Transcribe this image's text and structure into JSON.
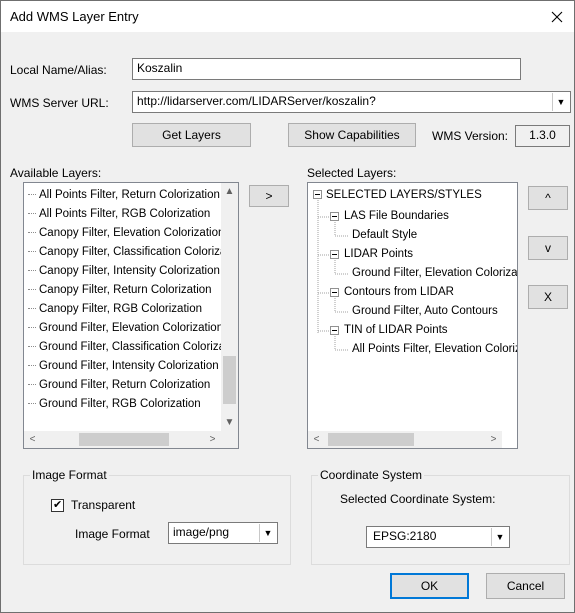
{
  "dialog": {
    "title": "Add WMS Layer Entry",
    "close_glyph": "✕"
  },
  "fields": {
    "local_name_label": "Local Name/Alias:",
    "local_name_value": "Koszalin",
    "wms_url_label": "WMS Server URL:",
    "wms_url_value": "http://lidarserver.com/LIDARServer/koszalin?"
  },
  "buttons": {
    "get_layers": "Get Layers",
    "show_capabilities": "Show Capabilities",
    "add_layer": ">",
    "move_up": "^",
    "move_down": "v",
    "remove": "X",
    "ok": "OK",
    "cancel": "Cancel"
  },
  "wms_version": {
    "label": "WMS Version:",
    "value": "1.3.0"
  },
  "available_layers": {
    "label": "Available Layers:",
    "items": [
      "All Points Filter, Return Colorization",
      "All Points Filter, RGB Colorization",
      "Canopy Filter, Elevation Colorization",
      "Canopy Filter, Classification Colorization",
      "Canopy Filter, Intensity Colorization",
      "Canopy Filter, Return Colorization",
      "Canopy Filter, RGB Colorization",
      "Ground Filter, Elevation Colorization",
      "Ground Filter, Classification Colorization",
      "Ground Filter, Intensity Colorization",
      "Ground Filter, Return Colorization",
      "Ground Filter, RGB Colorization"
    ]
  },
  "selected_layers": {
    "label": "Selected Layers:",
    "root": "SELECTED LAYERS/STYLES",
    "groups": [
      {
        "name": "LAS File Boundaries",
        "child": "Default Style"
      },
      {
        "name": "LIDAR Points",
        "child": "Ground Filter, Elevation Colorization"
      },
      {
        "name": "Contours from LIDAR",
        "child": "Ground Filter, Auto Contours"
      },
      {
        "name": "TIN of LIDAR Points",
        "child": "All Points Filter, Elevation Colorization"
      }
    ]
  },
  "image_format_group": {
    "title": "Image Format",
    "transparent_label": "Transparent",
    "transparent_checked": true,
    "check_glyph": "✔",
    "format_label": "Image Format",
    "format_value": "image/png"
  },
  "coordinate_group": {
    "title": "Coordinate System",
    "selected_label": "Selected Coordinate System:",
    "value": "EPSG:2180"
  },
  "icons": {
    "scroll_up": "▲",
    "scroll_down": "▼",
    "scroll_left": "<",
    "scroll_right": ">",
    "dropdown": "▼"
  }
}
